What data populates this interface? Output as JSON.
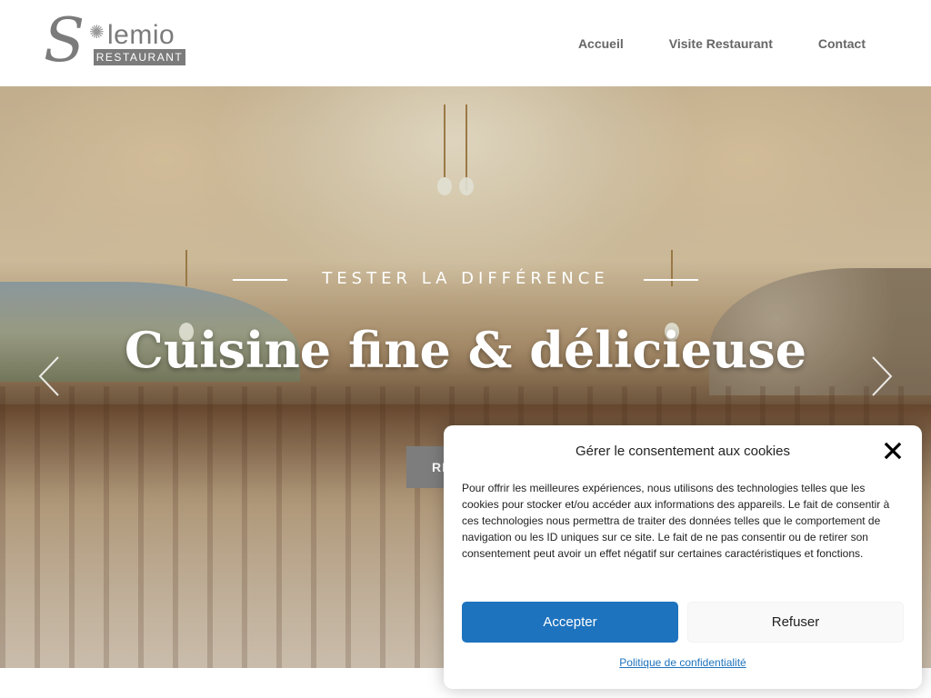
{
  "header": {
    "logo_text": "lemio",
    "logo_initial": "S",
    "logo_tag": "RESTAURANT",
    "nav": [
      {
        "label": "Accueil"
      },
      {
        "label": "Visite Restaurant"
      },
      {
        "label": "Contact"
      }
    ]
  },
  "hero": {
    "eyebrow": "TESTER LA DIFFÉRENCE",
    "title": "Cuisine fine & délicieuse",
    "button_label_partial": "RI"
  },
  "cookie_banner": {
    "title": "Gérer le consentement aux cookies",
    "body": "Pour offrir les meilleures expériences, nous utilisons des technologies telles que les cookies pour stocker et/ou accéder aux informations des appareils. Le fait de consentir à ces technologies nous permettra de traiter des données telles que le comportement de navigation ou les ID uniques sur ce site. Le fait de ne pas consentir ou de retirer son consentement peut avoir un effet négatif sur certaines caractéristiques et fonctions.",
    "accept_label": "Accepter",
    "refuse_label": "Refuser",
    "policy_link": "Politique de confidentialité"
  },
  "colors": {
    "accent": "#1e73be",
    "nav_text": "#666666",
    "logo_grey": "#7b7b7b"
  },
  "icons": {
    "prev": "chevron-left-icon",
    "next": "chevron-right-icon",
    "close": "close-icon",
    "logo_sun": "sun-icon"
  }
}
